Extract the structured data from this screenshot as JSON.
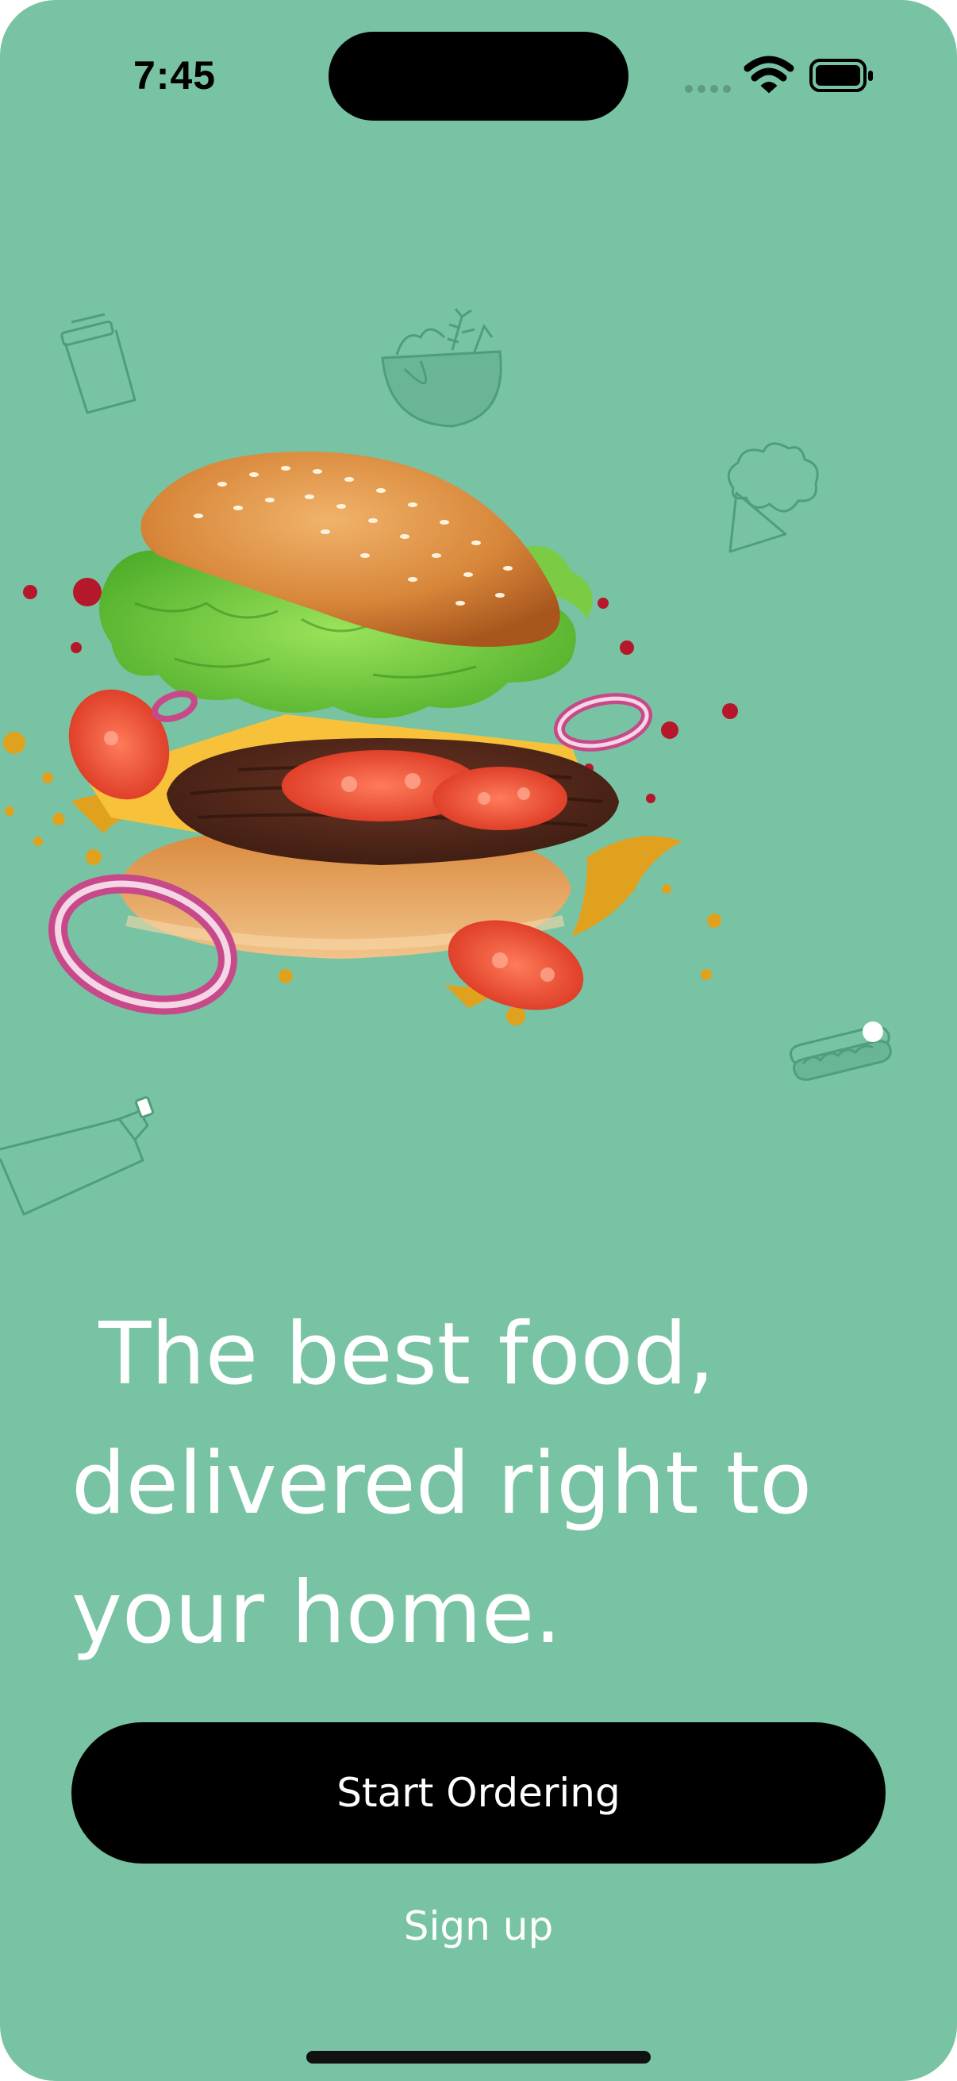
{
  "theme": {
    "background": "#78C3A3",
    "doodle_stroke": "#4E9E7E",
    "button_bg": "#000000",
    "text_light": "#FFFFFF"
  },
  "status_bar": {
    "time": "7:45",
    "icons": [
      "signal-icon",
      "wifi-icon",
      "battery-icon"
    ]
  },
  "hero": {
    "image": "burger-illustration",
    "doodles": [
      "coffee-cup-icon",
      "salad-bowl-icon",
      "ice-cream-icon",
      "bottle-icon",
      "hotdog-icon"
    ]
  },
  "headline": {
    "lines": [
      " The best food,",
      "delivered right to",
      "your home."
    ]
  },
  "actions": {
    "primary_label": "Start Ordering",
    "secondary_label": "Sign up"
  }
}
